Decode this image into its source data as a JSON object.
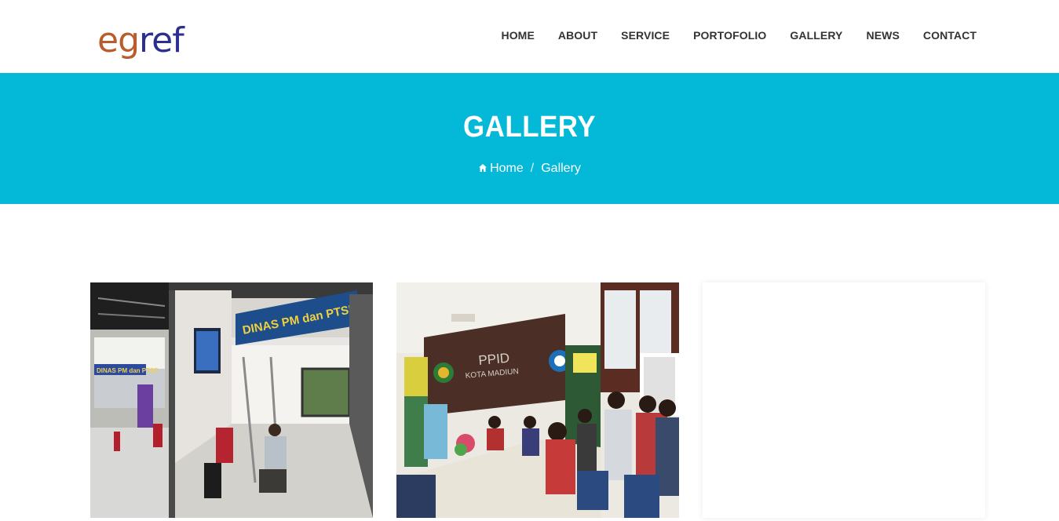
{
  "logo": {
    "part1": "eg",
    "part2": "ref"
  },
  "nav": {
    "home": "HOME",
    "about": "ABOUT",
    "service": "SERVICE",
    "portofolio": "PORTOFOLIO",
    "gallery": "GALLERY",
    "news": "NEWS",
    "contact": "CONTACT"
  },
  "banner": {
    "title": "GALLERY",
    "breadcrumb_home": "Home",
    "breadcrumb_sep": "/",
    "breadcrumb_current": "Gallery"
  },
  "gallery": {
    "photo1_sign": "DINAS PM dan PTSP",
    "photo1_small_sign": "DINAS PM dan PTSP",
    "photo2_sign1": "PPID",
    "photo2_sign2": "KOTA MADIUN"
  },
  "colors": {
    "banner": "#03b9d7",
    "logo_orange": "#b95d2b",
    "logo_blue": "#2c2f8f"
  }
}
